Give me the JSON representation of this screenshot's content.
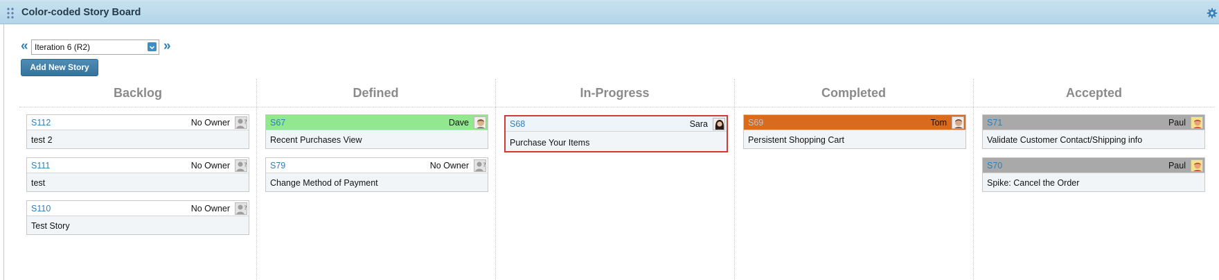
{
  "app": {
    "title": "Color-coded Story Board"
  },
  "iteration": {
    "selected": "Iteration 6 (R2)",
    "prev": "«",
    "next": "»"
  },
  "toolbar": {
    "add_label": "Add New Story"
  },
  "columns": [
    {
      "name": "Backlog"
    },
    {
      "name": "Defined"
    },
    {
      "name": "In-Progress"
    },
    {
      "name": "Completed"
    },
    {
      "name": "Accepted"
    }
  ],
  "cards": [
    {
      "id": "S112",
      "owner": "No Owner",
      "name": "test 2",
      "column": "Backlog",
      "color": "#ffffff",
      "avatar": "no-owner"
    },
    {
      "id": "S111",
      "owner": "No Owner",
      "name": "test",
      "column": "Backlog",
      "color": "#ffffff",
      "avatar": "no-owner"
    },
    {
      "id": "S110",
      "owner": "No Owner",
      "name": "Test Story",
      "column": "Backlog",
      "color": "#ffffff",
      "avatar": "no-owner"
    },
    {
      "id": "S67",
      "owner": "Dave",
      "name": "Recent Purchases View",
      "column": "Defined",
      "color": "#92e88e",
      "avatar": "user"
    },
    {
      "id": "S79",
      "owner": "No Owner",
      "name": "Change Method of Payment",
      "column": "Defined",
      "color": "#ffffff",
      "avatar": "no-owner"
    },
    {
      "id": "S68",
      "owner": "Sara",
      "name": "Purchase Your Items",
      "column": "In-Progress",
      "color": "#eef5fa",
      "avatar": "user",
      "selected": true
    },
    {
      "id": "S69",
      "owner": "Tom",
      "name": "Persistent Shopping Cart",
      "column": "Completed",
      "color": "#d86b1e",
      "avatar": "user"
    },
    {
      "id": "S71",
      "owner": "Paul",
      "name": "Validate Customer Contact/Shipping info",
      "column": "Accepted",
      "color": "#a9a9a9",
      "avatar": "user"
    },
    {
      "id": "S70",
      "owner": "Paul",
      "name": "Spike: Cancel the Order",
      "column": "Accepted",
      "color": "#a9a9a9",
      "avatar": "user"
    }
  ],
  "colors": {
    "titlebar": "#b3d6ea",
    "link": "#2d7fb8",
    "button": "#35739c",
    "selection": "#d23a2e"
  },
  "icons": [
    "grip-icon",
    "gear-icon",
    "dropdown-icon",
    "no-owner-icon",
    "user-avatar-icon"
  ]
}
